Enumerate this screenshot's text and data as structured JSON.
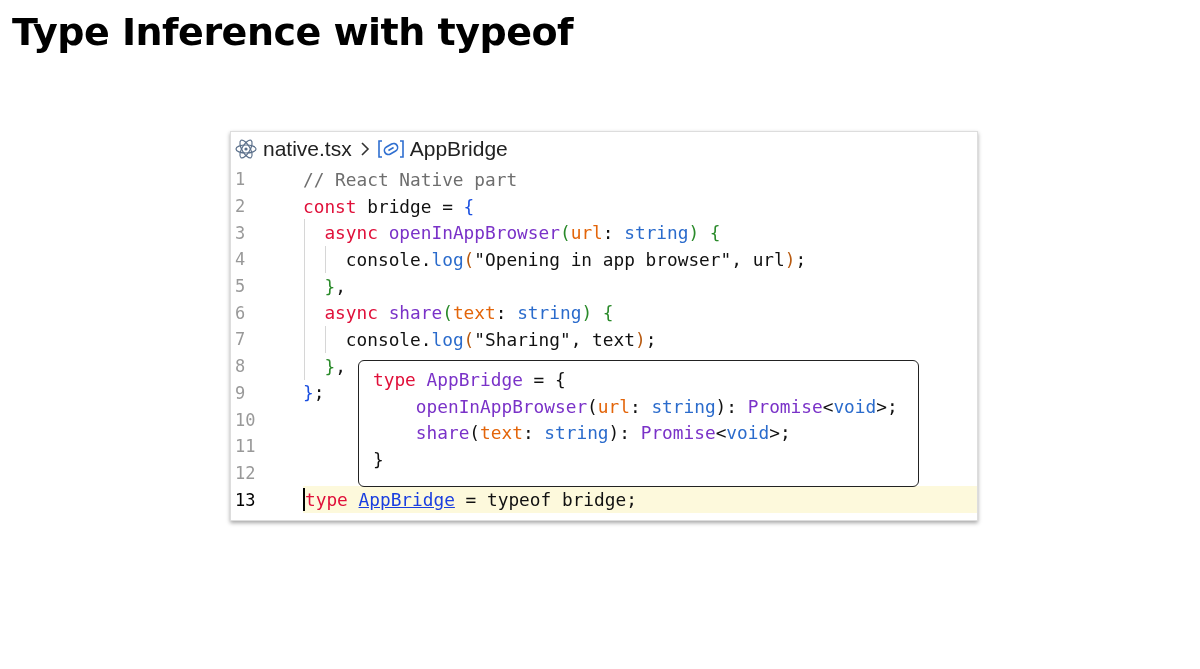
{
  "slide_title": "Type Inference with typeof",
  "editor": {
    "breadcrumb": {
      "file": "native.tsx",
      "symbol": "AppBridge"
    },
    "lines": [
      {
        "number": "1",
        "current": false,
        "tokens": [
          {
            "kind": "comment",
            "text": "// React Native part"
          }
        ]
      },
      {
        "number": "2",
        "current": false,
        "tokens": [
          {
            "kind": "keyword",
            "text": "const"
          },
          {
            "kind": "plain",
            "text": " bridge = "
          },
          {
            "kind": "bracket1",
            "text": "{"
          }
        ]
      },
      {
        "number": "3",
        "current": false,
        "tokens": [
          {
            "kind": "keyword",
            "text": "  async "
          },
          {
            "kind": "function",
            "text": "openInAppBrowser"
          },
          {
            "kind": "bracket2",
            "text": "("
          },
          {
            "kind": "param",
            "text": "url"
          },
          {
            "kind": "plain",
            "text": ": "
          },
          {
            "kind": "type",
            "text": "string"
          },
          {
            "kind": "bracket2",
            "text": ") {"
          }
        ]
      },
      {
        "number": "4",
        "current": false,
        "tokens": [
          {
            "kind": "plain",
            "text": "    console."
          },
          {
            "kind": "type",
            "text": "log"
          },
          {
            "kind": "bracket3",
            "text": "("
          },
          {
            "kind": "plain",
            "text": "\"Opening in app browser\", url"
          },
          {
            "kind": "bracket3",
            "text": ")"
          },
          {
            "kind": "plain",
            "text": ";"
          }
        ]
      },
      {
        "number": "5",
        "current": false,
        "tokens": [
          {
            "kind": "bracket2",
            "text": "  }"
          },
          {
            "kind": "plain",
            "text": ","
          }
        ]
      },
      {
        "number": "6",
        "current": false,
        "tokens": [
          {
            "kind": "keyword",
            "text": "  async "
          },
          {
            "kind": "function",
            "text": "share"
          },
          {
            "kind": "bracket2",
            "text": "("
          },
          {
            "kind": "param",
            "text": "text"
          },
          {
            "kind": "plain",
            "text": ": "
          },
          {
            "kind": "type",
            "text": "string"
          },
          {
            "kind": "bracket2",
            "text": ") {"
          }
        ]
      },
      {
        "number": "7",
        "current": false,
        "tokens": [
          {
            "kind": "plain",
            "text": "    console."
          },
          {
            "kind": "type",
            "text": "log"
          },
          {
            "kind": "bracket3",
            "text": "("
          },
          {
            "kind": "plain",
            "text": "\"Sharing\", text"
          },
          {
            "kind": "bracket3",
            "text": ")"
          },
          {
            "kind": "plain",
            "text": ";"
          }
        ]
      },
      {
        "number": "8",
        "current": false,
        "tokens": [
          {
            "kind": "bracket2",
            "text": "  }"
          },
          {
            "kind": "plain",
            "text": ","
          }
        ]
      },
      {
        "number": "9",
        "current": false,
        "tokens": [
          {
            "kind": "bracket1",
            "text": "}"
          },
          {
            "kind": "plain",
            "text": ";"
          }
        ]
      },
      {
        "number": "10",
        "current": false
      },
      {
        "number": "11",
        "current": false
      },
      {
        "number": "12",
        "current": false
      },
      {
        "number": "13",
        "current": true,
        "tokens": [
          {
            "kind": "keyword",
            "text": "type "
          },
          {
            "kind": "link",
            "text": "AppBridge"
          },
          {
            "kind": "plain",
            "text": " = typeof bridge;"
          }
        ]
      }
    ],
    "hover": {
      "lines": [
        {
          "tokens": [
            {
              "kind": "keyword",
              "text": "type "
            },
            {
              "kind": "function",
              "text": "AppBridge"
            },
            {
              "kind": "plain",
              "text": " = {"
            }
          ]
        },
        {
          "tokens": [
            {
              "kind": "function",
              "text": "    openInAppBrowser"
            },
            {
              "kind": "plain",
              "text": "("
            },
            {
              "kind": "param",
              "text": "url"
            },
            {
              "kind": "plain",
              "text": ": "
            },
            {
              "kind": "type",
              "text": "string"
            },
            {
              "kind": "plain",
              "text": "): "
            },
            {
              "kind": "function",
              "text": "Promise"
            },
            {
              "kind": "plain",
              "text": "<"
            },
            {
              "kind": "type",
              "text": "void"
            },
            {
              "kind": "plain",
              "text": ">;"
            }
          ]
        },
        {
          "tokens": [
            {
              "kind": "function",
              "text": "    share"
            },
            {
              "kind": "plain",
              "text": "("
            },
            {
              "kind": "param",
              "text": "text"
            },
            {
              "kind": "plain",
              "text": ": "
            },
            {
              "kind": "type",
              "text": "string"
            },
            {
              "kind": "plain",
              "text": "): "
            },
            {
              "kind": "function",
              "text": "Promise"
            },
            {
              "kind": "plain",
              "text": "<"
            },
            {
              "kind": "type",
              "text": "void"
            },
            {
              "kind": "plain",
              "text": ">;"
            }
          ]
        },
        {
          "tokens": [
            {
              "kind": "plain",
              "text": "}"
            }
          ]
        }
      ]
    }
  }
}
